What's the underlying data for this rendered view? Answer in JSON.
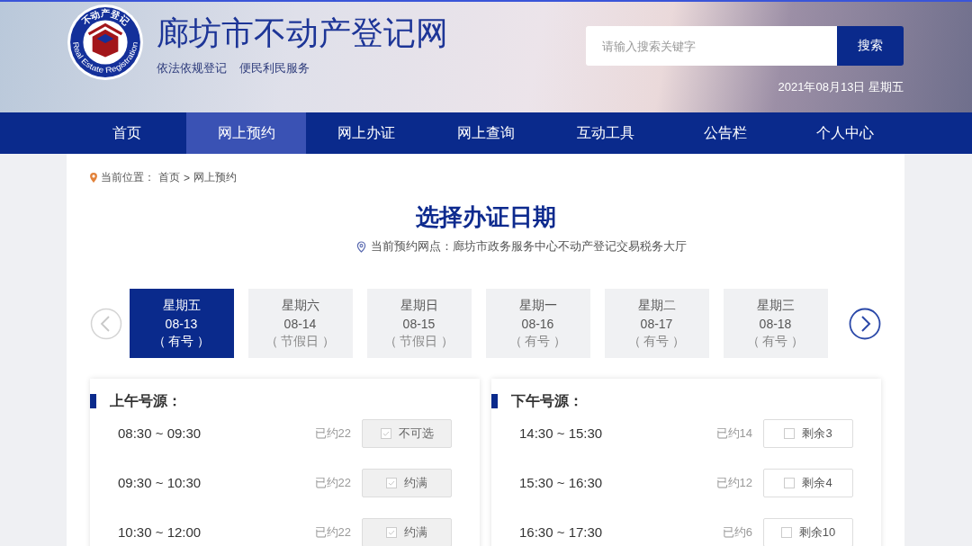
{
  "header": {
    "logo": {
      "top_text": "不动产登记",
      "bottom_text": "Real Estate Registration"
    },
    "site_title": "廊坊市不动产登记网",
    "slogans": [
      "依法依规登记",
      "便民利民服务"
    ],
    "search": {
      "placeholder": "请输入搜索关键字",
      "button": "搜索"
    },
    "date": "2021年08月13日 星期五"
  },
  "nav": [
    {
      "label": "首页",
      "selected": false
    },
    {
      "label": "网上预约",
      "selected": true
    },
    {
      "label": "网上办证",
      "selected": false
    },
    {
      "label": "网上查询",
      "selected": false
    },
    {
      "label": "互动工具",
      "selected": false
    },
    {
      "label": "公告栏",
      "selected": false
    },
    {
      "label": "个人中心",
      "selected": false
    }
  ],
  "breadcrumb": {
    "label": "当前位置：",
    "items": [
      "首页",
      "网上预约"
    ],
    "separator": ">"
  },
  "page_title": "选择办证日期",
  "location": "当前预约网点：廊坊市政务服务中心不动产登记交易税务大厅",
  "dates": [
    {
      "weekday": "星期五",
      "date": "08-13",
      "status": "（ 有号 ）",
      "selected": true
    },
    {
      "weekday": "星期六",
      "date": "08-14",
      "status": "（ 节假日 ）",
      "selected": false
    },
    {
      "weekday": "星期日",
      "date": "08-15",
      "status": "（ 节假日 ）",
      "selected": false
    },
    {
      "weekday": "星期一",
      "date": "08-16",
      "status": "（ 有号 ）",
      "selected": false
    },
    {
      "weekday": "星期二",
      "date": "08-17",
      "status": "（ 有号 ）",
      "selected": false
    },
    {
      "weekday": "星期三",
      "date": "08-18",
      "status": "（ 有号 ）",
      "selected": false
    }
  ],
  "sessions": [
    {
      "title": "上午号源：",
      "slots": [
        {
          "time": "08:30 ~ 09:30",
          "booked": "已约22",
          "label": "不可选",
          "disabled": true
        },
        {
          "time": "09:30 ~ 10:30",
          "booked": "已约22",
          "label": "约满",
          "disabled": true
        },
        {
          "time": "10:30 ~ 12:00",
          "booked": "已约22",
          "label": "约满",
          "disabled": true
        }
      ]
    },
    {
      "title": "下午号源：",
      "slots": [
        {
          "time": "14:30 ~ 15:30",
          "booked": "已约14",
          "label": "剩余3",
          "disabled": false
        },
        {
          "time": "15:30 ~ 16:30",
          "booked": "已约12",
          "label": "剩余4",
          "disabled": false
        },
        {
          "time": "16:30 ~ 17:30",
          "booked": "已约6",
          "label": "剩余10",
          "disabled": false
        }
      ]
    }
  ]
}
